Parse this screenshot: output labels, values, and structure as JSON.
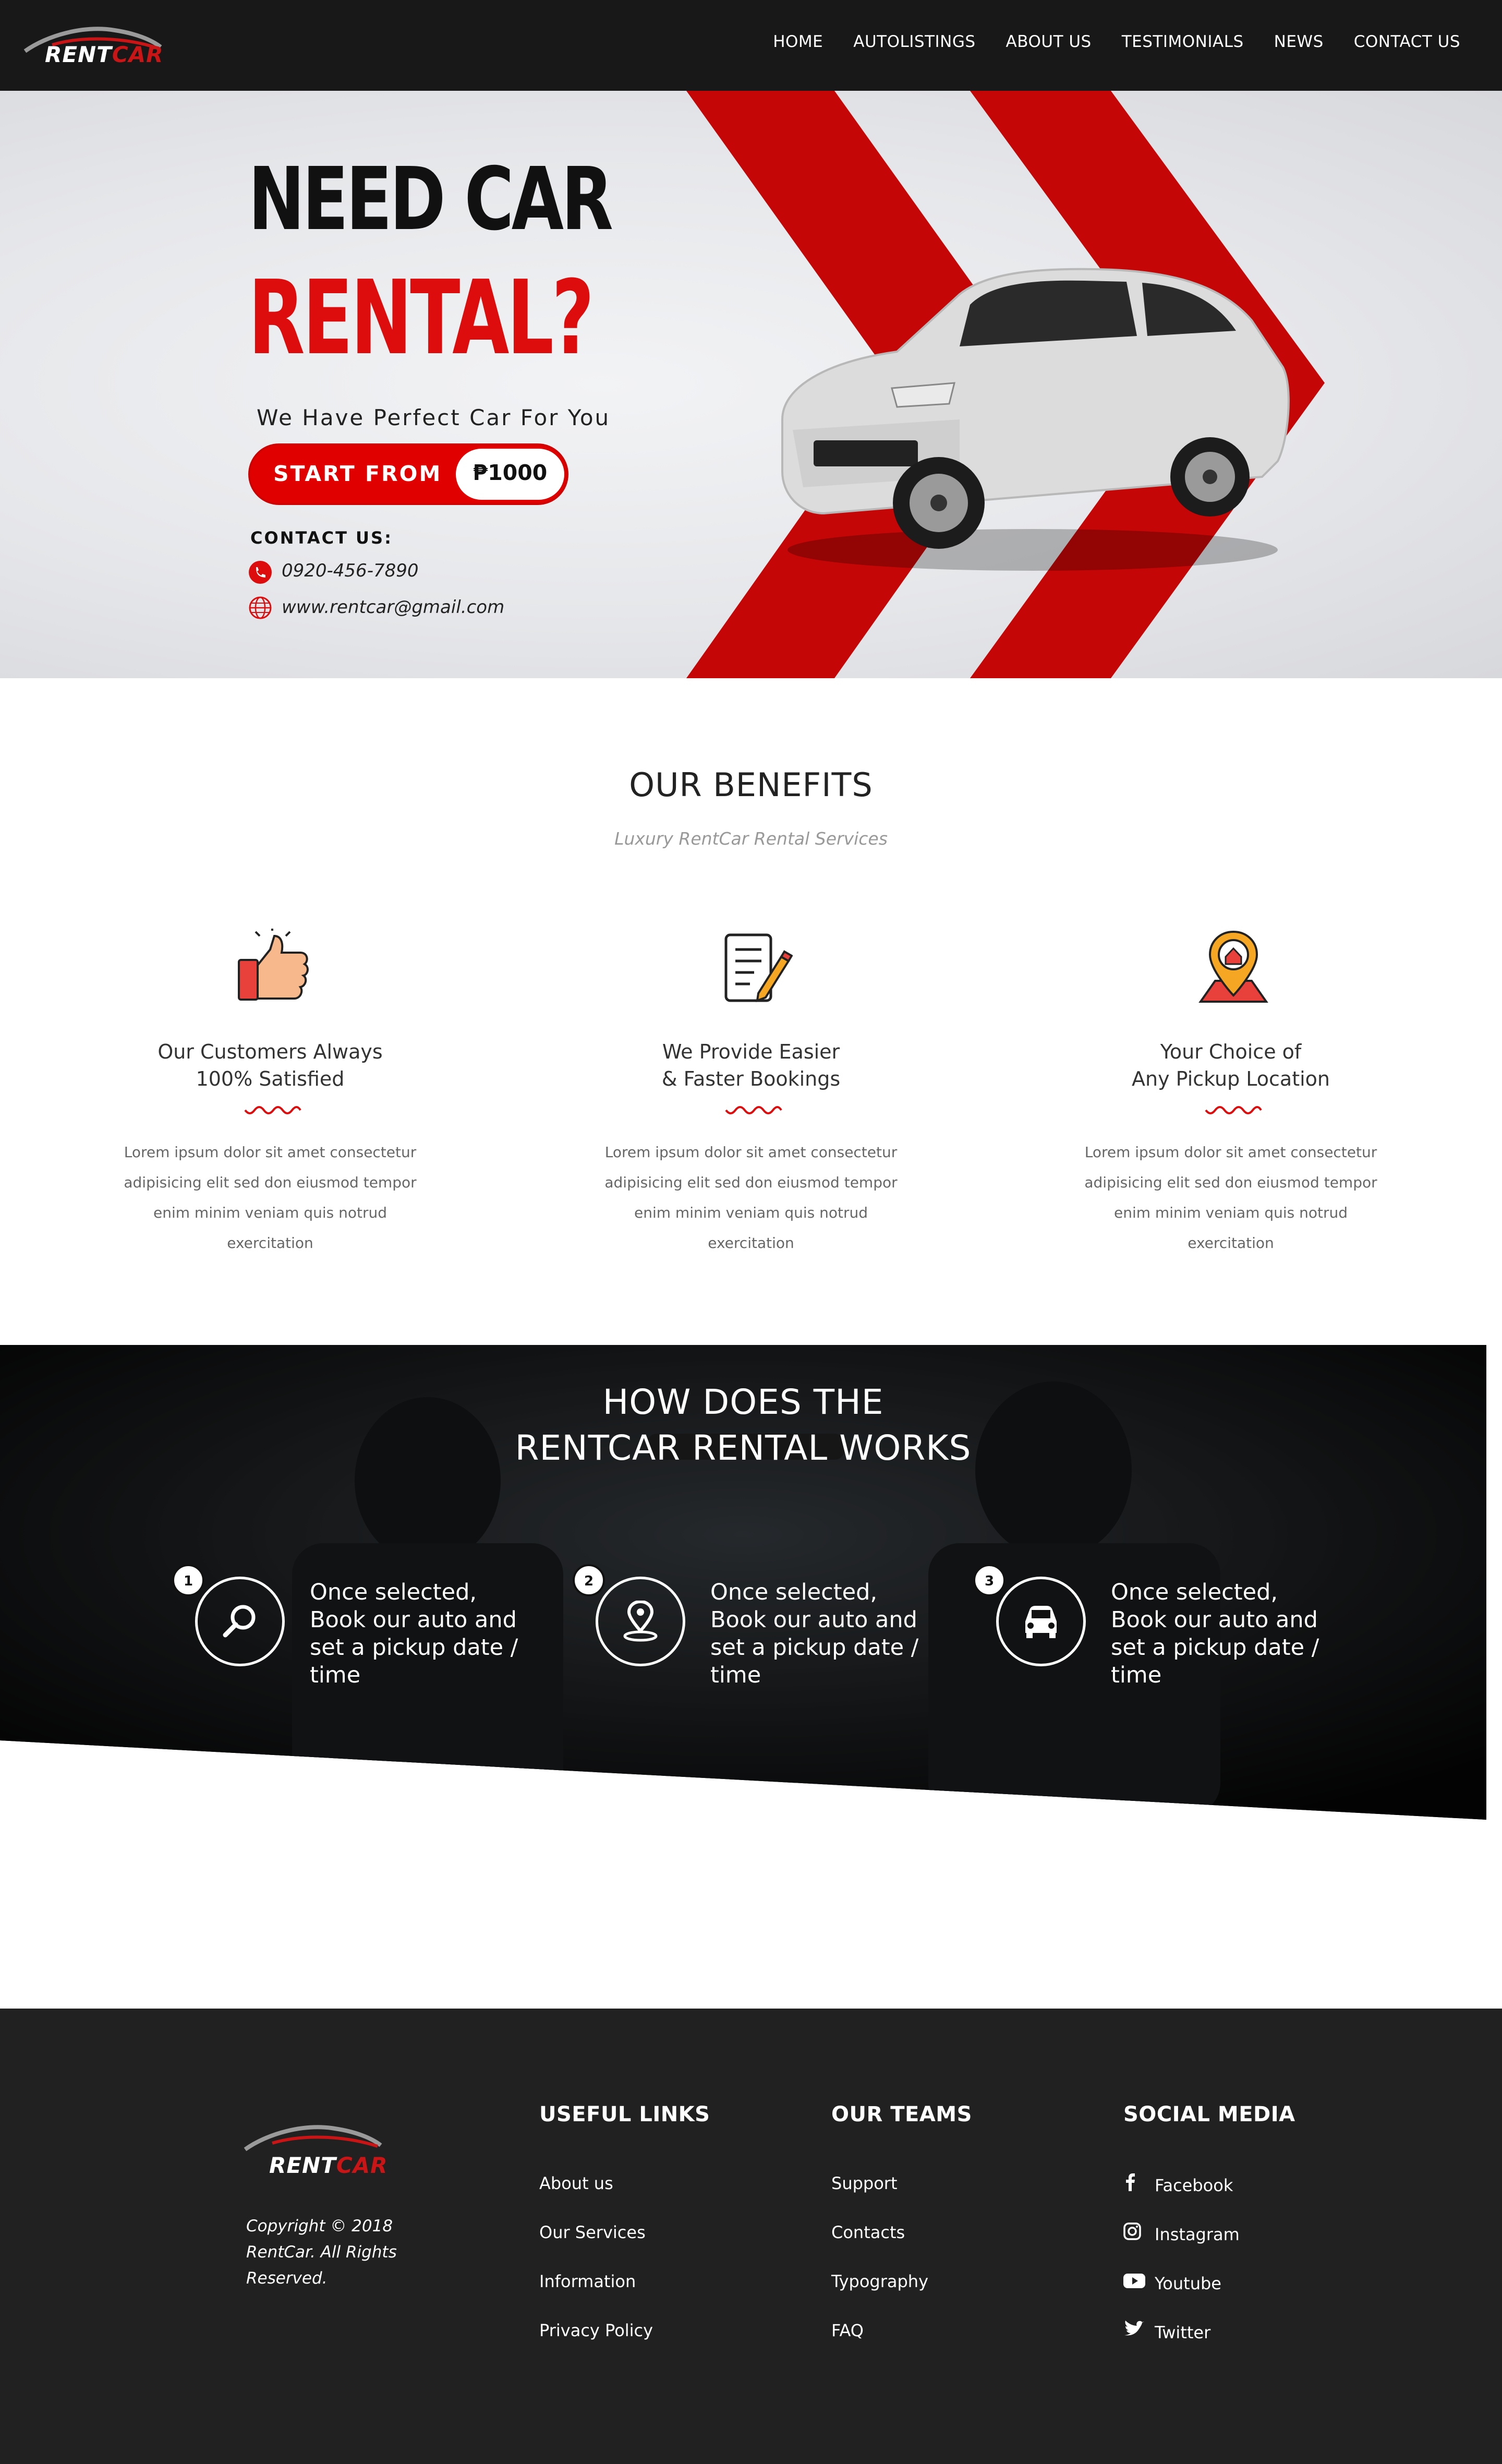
{
  "brand": {
    "name_part1": "RENT",
    "name_part2": "CAR",
    "accent": "#dd0d0d"
  },
  "nav": {
    "items": [
      "HOME",
      "AUTOLISTINGS",
      "ABOUT US",
      "TESTIMONIALS",
      "NEWS",
      "CONTACT US"
    ]
  },
  "hero": {
    "title_line1": "NEED CAR",
    "title_line2": "RENTAL?",
    "subtitle": "We Have Perfect Car For You",
    "cta_label": "START FROM",
    "price": "₱1000",
    "contact_label": "CONTACT US:",
    "phone": "0920-456-7890",
    "website": "www.rentcar@gmail.com"
  },
  "benefits": {
    "title": "OUR BENEFITS",
    "subtitle": "Luxury RentCar Rental Services",
    "items": [
      {
        "icon": "thumbs-up-icon",
        "heading": "Our Customers Always\n100% Satisfied",
        "text": "Lorem ipsum dolor sit amet consectetur adipisicing elit sed don eiusmod tempor enim minim veniam quis notrud exercitation"
      },
      {
        "icon": "notepad-pencil-icon",
        "heading": "We Provide Easier\n& Faster Bookings",
        "text": "Lorem ipsum dolor sit amet consectetur adipisicing elit sed don eiusmod tempor enim minim veniam quis notrud exercitation"
      },
      {
        "icon": "location-pin-house-icon",
        "heading": "Your Choice of\nAny Pickup Location",
        "text": "Lorem ipsum dolor sit amet consectetur adipisicing elit sed don eiusmod tempor enim minim veniam quis notrud exercitation"
      }
    ]
  },
  "how": {
    "title_line1": "HOW DOES THE",
    "title_line2": "RENTCAR RENTAL WORKS",
    "steps": [
      {
        "num": "1",
        "icon": "search-icon",
        "text": "Once selected, Book our auto and set a pickup date / time"
      },
      {
        "num": "2",
        "icon": "map-pin-icon",
        "text": "Once selected, Book our auto and set a pickup date / time"
      },
      {
        "num": "3",
        "icon": "car-icon",
        "text": "Once selected, Book our auto and set a pickup date / time"
      }
    ]
  },
  "footer": {
    "copyright": "Copyright © 2018 RentCar. All Rights Reserved.",
    "useful_links": {
      "heading": "USEFUL LINKS",
      "items": [
        "About us",
        "Our Services",
        "Information",
        "Privacy Policy"
      ]
    },
    "our_teams": {
      "heading": "OUR TEAMS",
      "items": [
        "Support",
        "Contacts",
        "Typography",
        "FAQ"
      ]
    },
    "social_media": {
      "heading": "SOCIAL MEDIA",
      "items": [
        {
          "icon": "facebook-icon",
          "label": "Facebook"
        },
        {
          "icon": "instagram-icon",
          "label": "Instagram"
        },
        {
          "icon": "youtube-icon",
          "label": "Youtube"
        },
        {
          "icon": "twitter-icon",
          "label": "Twitter"
        }
      ]
    }
  }
}
